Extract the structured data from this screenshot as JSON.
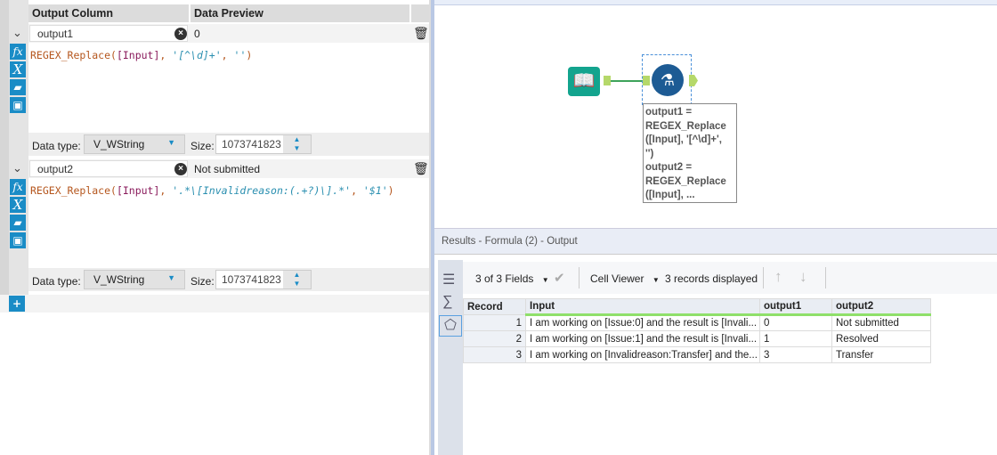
{
  "formula_panel": {
    "headers": {
      "output_column": "Output Column",
      "data_preview": "Data Preview"
    },
    "fields": [
      {
        "name": "output1",
        "preview": "0",
        "expression": {
          "func": "REGEX_Replace(",
          "field": "[Input]",
          "sep1": ", ",
          "pattern": "'[^\\d]+'",
          "sep2": ", ",
          "repl": "''",
          "close": ")"
        },
        "data_type_label": "Data type:",
        "data_type": "V_WString",
        "size_label": "Size:",
        "size": "1073741823"
      },
      {
        "name": "output2",
        "preview": "Not submitted",
        "expression": {
          "func": "REGEX_Replace(",
          "field": "[Input]",
          "sep1": ", ",
          "pattern": "'.*\\[Invalidreason:(.+?)\\].*'",
          "sep2": ", ",
          "repl": "'$1'",
          "close": ")"
        },
        "data_type_label": "Data type:",
        "data_type": "V_WString",
        "size_label": "Size:",
        "size": "1073741823"
      }
    ],
    "add_label": "+"
  },
  "canvas": {
    "annotation": [
      "output1 =",
      "REGEX_Replace",
      "([Input], '[^\\d]+',",
      "'')",
      "output2 =",
      "REGEX_Replace",
      "([Input], ..."
    ]
  },
  "results": {
    "title": "Results - Formula (2) - Output",
    "fields_label": "3 of 3 Fields",
    "cell_viewer_label": "Cell Viewer",
    "records_label": "3 records displayed",
    "columns": [
      "Record",
      "Input",
      "output1",
      "output2"
    ],
    "rows": [
      [
        "1",
        "I am working on [Issue:0] and the result is [Invali...",
        "0",
        "Not submitted"
      ],
      [
        "2",
        "I am working on [Issue:1] and the result is [Invali...",
        "1",
        "Resolved"
      ],
      [
        "3",
        "I am working on [Invalidreason:Transfer]  and the...",
        "3",
        "Transfer"
      ]
    ]
  }
}
